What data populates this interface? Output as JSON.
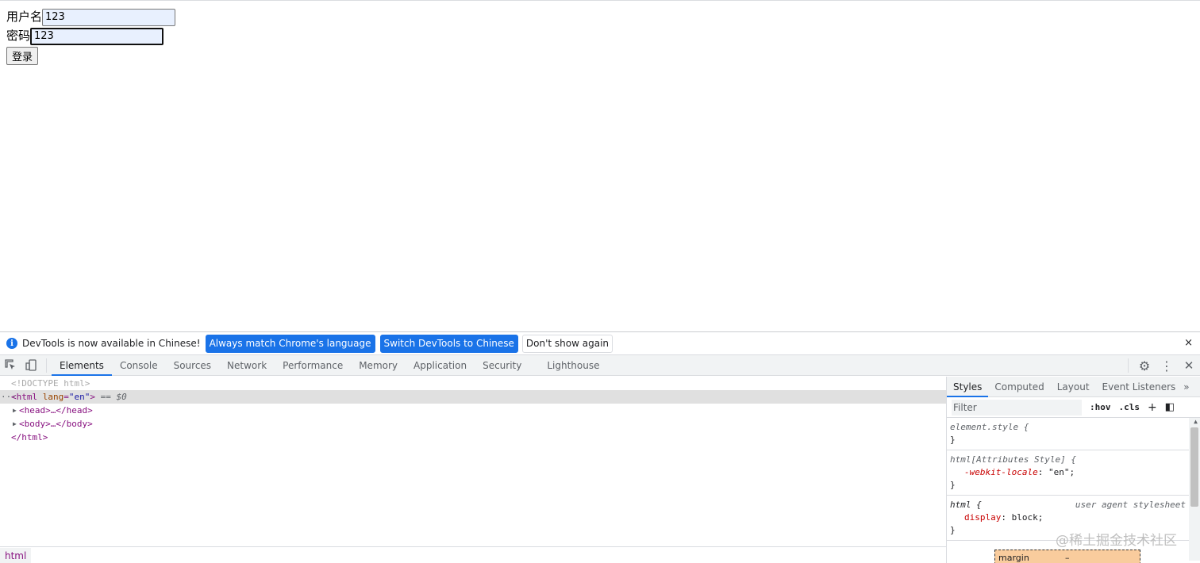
{
  "page": {
    "username_label": "用户名",
    "username_value": "123",
    "password_label": "密码",
    "password_value": "123",
    "login_label": "登录"
  },
  "infobar": {
    "icon": "info-icon",
    "message": "DevTools is now available in Chinese!",
    "btn_match": "Always match Chrome's language",
    "btn_switch": "Switch DevTools to Chinese",
    "btn_dismiss": "Don't show again",
    "close": "×"
  },
  "tabs": {
    "items": [
      "Elements",
      "Console",
      "Sources",
      "Network",
      "Performance",
      "Memory",
      "Application",
      "Security",
      "Lighthouse"
    ],
    "active": "Elements"
  },
  "toolbar_right": {
    "settings": "⚙",
    "more": "⋮",
    "close": "✕"
  },
  "dom": {
    "doctype": "<!DOCTYPE html>",
    "dots": "···",
    "html_open": "<html",
    "lang_attr": "lang",
    "lang_val": "\"en\"",
    "html_close_bracket": ">",
    "eq_ref": "== $0",
    "head": "<head>…</head>",
    "body": "<body>…</body>",
    "html_end": "</html>"
  },
  "breadcrumb": {
    "item": "html"
  },
  "sidebar": {
    "tabs": [
      "Styles",
      "Computed",
      "Layout",
      "Event Listeners"
    ],
    "active": "Styles",
    "more": "»",
    "filter_placeholder": "Filter",
    "hov": ":hov",
    "cls": ".cls",
    "plus": "+",
    "toggle": "◧",
    "rules": {
      "element_style": "element.style {",
      "close_brace": "}",
      "attr_style": "html[Attributes Style] {",
      "attr_prop": "-webkit-locale",
      "attr_val": "\"en\";",
      "html_sel": "html {",
      "html_origin": "user agent stylesheet",
      "html_prop": "display",
      "html_val": "block;"
    },
    "boxmodel_label": "margin",
    "boxmodel_dash": "–"
  },
  "watermark": "@稀土掘金技术社区"
}
